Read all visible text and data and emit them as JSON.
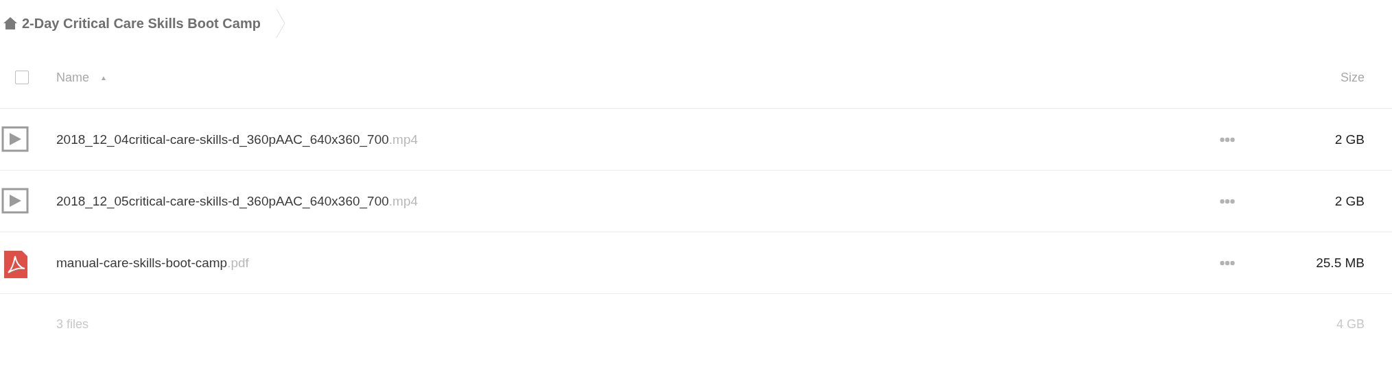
{
  "breadcrumb": {
    "title": "2-Day Critical Care Skills Boot Camp"
  },
  "table": {
    "select_all": {
      "checked": false
    },
    "columns": [
      {
        "label": "Name",
        "sort_icon": "▲"
      },
      {
        "label": "Size"
      }
    ],
    "rows": [
      {
        "kind": "video",
        "name": "2018_12_04critical-care-skills-d_360pAAC_640x360_700.mp4",
        "size": "2 GB"
      },
      {
        "kind": "video",
        "name": "2018_12_05critical-care-skills-d_360pAAC_640x360_700.mp4",
        "size": "2 GB"
      },
      {
        "kind": "pdf",
        "name": "manual-care-skills-boot-camp.pdf",
        "size": "25.5 MB"
      }
    ],
    "summary": {
      "count": "3 files",
      "total": "4 GB"
    }
  }
}
